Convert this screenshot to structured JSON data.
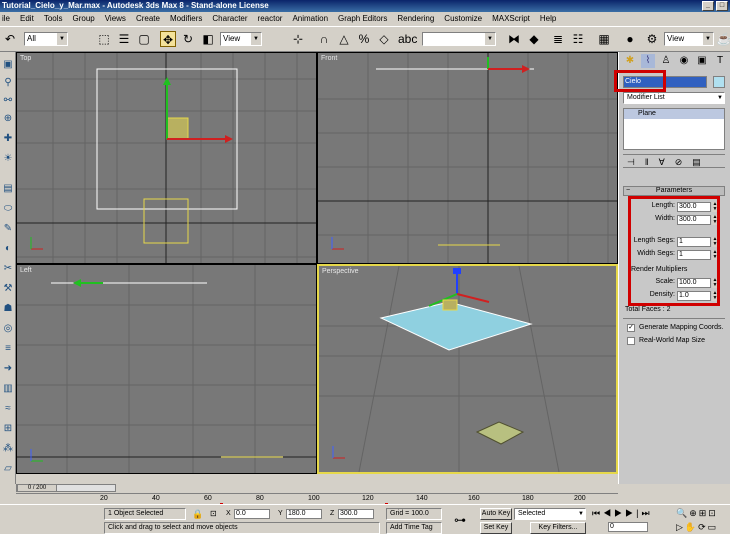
{
  "window": {
    "title": "Tutorial_Cielo_y_Mar.max - Autodesk 3ds Max 8 - Stand-alone License"
  },
  "menu": [
    "ile",
    "Edit",
    "Tools",
    "Group",
    "Views",
    "Create",
    "Modifiers",
    "Character",
    "reactor",
    "Animation",
    "Graph Editors",
    "Rendering",
    "Customize",
    "MAXScript",
    "Help"
  ],
  "toolbar": {
    "selection_filter": "All",
    "reference_coord": "View",
    "reference_coord_2": "View",
    "named_selection": ""
  },
  "viewports": {
    "top": "Top",
    "front": "Front",
    "left": "Left",
    "perspective": "Perspective"
  },
  "command_panel": {
    "object_name": "Cielo",
    "modifier_list": "Modifier List",
    "stack_item": "Plane",
    "rollout_title": "Parameters",
    "params": {
      "length_label": "Length:",
      "length_value": "300.0",
      "width_label": "Width:",
      "width_value": "300.0",
      "length_segs_label": "Length Segs:",
      "length_segs_value": "1",
      "width_segs_label": "Width Segs:",
      "width_segs_value": "1",
      "render_multipliers_label": "Render Multipliers",
      "scale_label": "Scale:",
      "scale_value": "100.0",
      "density_label": "Density:",
      "density_value": "1.0",
      "total_faces": "Total Faces : 2",
      "generate_mapping": "Generate Mapping Coords.",
      "real_world": "Real-World Map Size",
      "generate_mapping_checked": true,
      "real_world_checked": false
    }
  },
  "timeline": {
    "frame_display": "0 / 200",
    "ticks": [
      "20",
      "40",
      "60",
      "80",
      "100",
      "120",
      "140",
      "160",
      "180",
      "200"
    ]
  },
  "status": {
    "selection": "1 Object Selected",
    "prompt": "Click and drag to select and move objects",
    "x_label": "X",
    "x_value": "0.0",
    "y_label": "Y",
    "y_value": "180.0",
    "z_label": "Z",
    "z_value": "300.0",
    "grid": "Grid = 100.0",
    "add_time_tag": "Add Time Tag",
    "auto_key": "Auto Key",
    "set_key": "Set Key",
    "key_mode": "Selected",
    "key_filters": "Key Filters...",
    "current_frame": "0"
  },
  "colors": {
    "highlight": "#d00000",
    "viewport_bg": "#787878",
    "active_border": "#e6d84a",
    "plane_fill": "#8fd0e0"
  }
}
